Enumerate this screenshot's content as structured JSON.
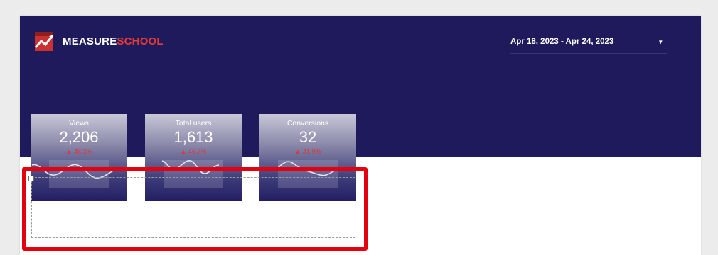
{
  "brand": {
    "logo_part1": "MEASURE",
    "logo_part2": "SCHOOL",
    "accent": "#e33a3a",
    "logo_icon": "chart-arrow-icon"
  },
  "date_range": {
    "label": "Apr 18, 2023 - Apr 24, 2023",
    "icon": "caret-down-icon"
  },
  "scorecards": [
    {
      "title": "Views",
      "value": "2,206",
      "delta": "▲ 48.3%"
    },
    {
      "title": "Total users",
      "value": "1,613",
      "delta": "▲ 46.7%"
    },
    {
      "title": "Conversions",
      "value": "32",
      "delta": "▲ 41.9%"
    }
  ],
  "colors": {
    "header_band": "#1f1a5b",
    "highlight": "#e3000f",
    "delta": "#e2343a"
  }
}
